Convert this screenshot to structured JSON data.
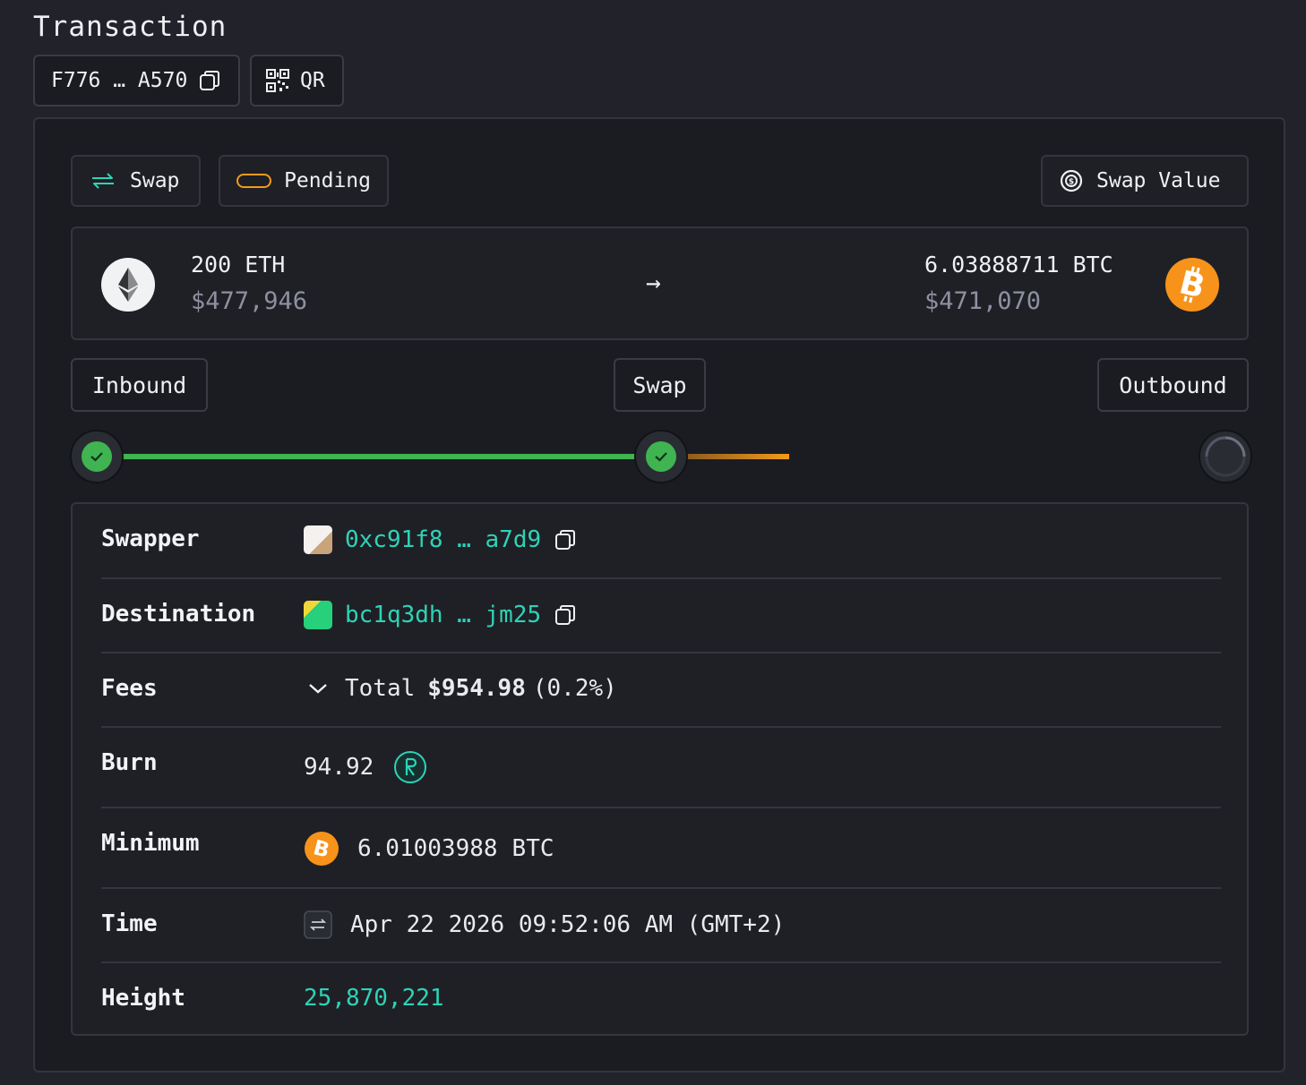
{
  "header": {
    "title": "Transaction",
    "tx_hash": "F776 … A570",
    "qr_label": "QR"
  },
  "badges": {
    "type_label": "Swap",
    "status_label": "Pending",
    "swap_value_label": "Swap Value"
  },
  "swap": {
    "from_amount": "200 ETH",
    "from_usd": "$477,946",
    "to_amount": "6.03888711 BTC",
    "to_usd": "$471,070",
    "arrow": "→"
  },
  "progress": {
    "stages": [
      "Inbound",
      "Swap",
      "Outbound"
    ],
    "inbound_done": true,
    "swap_done": true,
    "outbound_pending": true
  },
  "details": {
    "swapper_label": "Swapper",
    "swapper_address": "0xc91f8 … a7d9",
    "destination_label": "Destination",
    "destination_address": "bc1q3dh … jm25",
    "fees_label": "Fees",
    "fees_total_label": "Total",
    "fees_total_value": "$954.98",
    "fees_percent": "(0.2%)",
    "burn_label": "Burn",
    "burn_value": "94.92",
    "minimum_label": "Minimum",
    "minimum_value": "6.01003988",
    "minimum_unit": "BTC",
    "time_label": "Time",
    "time_value": "Apr 22 2026 09:52:06 AM (GMT+2)",
    "height_label": "Height",
    "height_value": "25,870,221"
  },
  "colors": {
    "accent_teal": "#2ed3b7",
    "success_green": "#3fb451",
    "pending_orange": "#f39a1c",
    "btc_orange": "#f7931a"
  }
}
